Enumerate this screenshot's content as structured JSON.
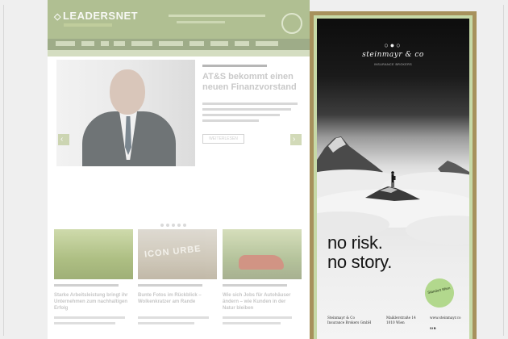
{
  "site": {
    "logo_text": "LEADERSNET",
    "logo_glyph": "◇",
    "article": {
      "title": "AT&S bekommt einen neuen Finanzvorstand",
      "more_label": "WEITERLESEN"
    },
    "carousel": {
      "prev_icon": "‹",
      "next_icon": "›"
    },
    "cards": [
      {
        "title": "Starke Arbeitsleistung bringt ihr Unternehmen zum nachhaltigen Erfolg"
      },
      {
        "title": "Bunte Fotos im Rückblick – Wolkenkratzer am Rande",
        "sign_text": "ICON URBE"
      },
      {
        "title": "Wie sich Jobs für Autohäuser ändern – wie Kunden in der Natur bleiben"
      }
    ]
  },
  "ad": {
    "brand_mark": "○●○",
    "brand_name": "steinmayr & co",
    "brand_sub": "INSURANCE BROKERS",
    "tagline_line1": "no risk.",
    "tagline_line2": "no story.",
    "location_badge": "Standort Wien",
    "footer_col1": [
      "Steinmayr & Co",
      "Insurance Brokers GmbH"
    ],
    "footer_col2": [
      "Maiklerstraße 14",
      "1010 Wien"
    ],
    "footer_col3": [
      "www.steinmayr.co"
    ],
    "footer_logo": "SIB"
  },
  "colors": {
    "site_header": "#6f8a39",
    "ad_frame": "#a7915c",
    "ad_inner_border": "#c6d9a7",
    "badge": "#b2d88d"
  }
}
